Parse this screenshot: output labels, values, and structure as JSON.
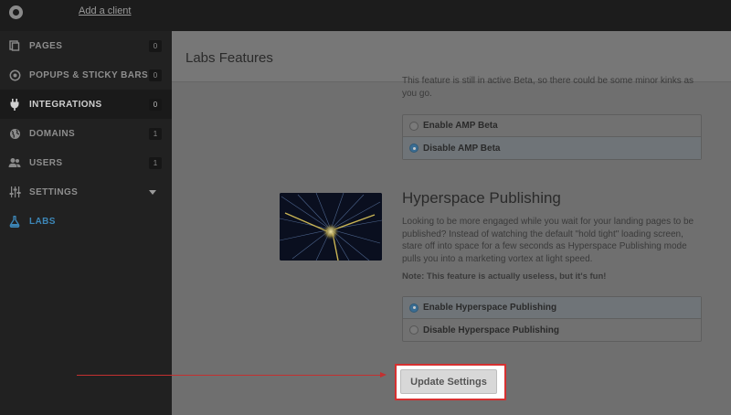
{
  "topbar": {
    "add_client": "Add a client"
  },
  "sidebar": {
    "items": [
      {
        "label": "PAGES",
        "badge": "0",
        "icon": "pages-icon"
      },
      {
        "label": "POPUPS & STICKY BARS",
        "badge": "0",
        "icon": "popups-icon"
      },
      {
        "label": "INTEGRATIONS",
        "badge": "0",
        "icon": "plug-icon"
      },
      {
        "label": "DOMAINS",
        "badge": "1",
        "icon": "globe-icon"
      },
      {
        "label": "USERS",
        "badge": "1",
        "icon": "users-icon"
      },
      {
        "label": "SETTINGS",
        "icon": "sliders-icon"
      },
      {
        "label": "LABS",
        "icon": "flask-icon"
      }
    ]
  },
  "main": {
    "title": "Labs Features",
    "amp": {
      "description": "This feature is still in active Beta, so there could be some minor kinks as you go.",
      "options": [
        {
          "label": "Enable AMP Beta",
          "selected": false
        },
        {
          "label": "Disable AMP Beta",
          "selected": true
        }
      ]
    },
    "hyperspace": {
      "title": "Hyperspace Publishing",
      "description": "Looking to be more engaged while you wait for your landing pages to be published? Instead of watching the default \"hold tight\" loading screen, stare off into space for a few seconds as Hyperspace Publishing mode pulls you into a marketing vortex at light speed.",
      "note": "Note: This feature is actually useless, but it's fun!",
      "options": [
        {
          "label": "Enable Hyperspace Publishing",
          "selected": true
        },
        {
          "label": "Disable Hyperspace Publishing",
          "selected": false
        }
      ]
    },
    "update_button": "Update Settings"
  },
  "colors": {
    "accent_blue": "#3d87b8",
    "highlight_red": "#d63030"
  }
}
